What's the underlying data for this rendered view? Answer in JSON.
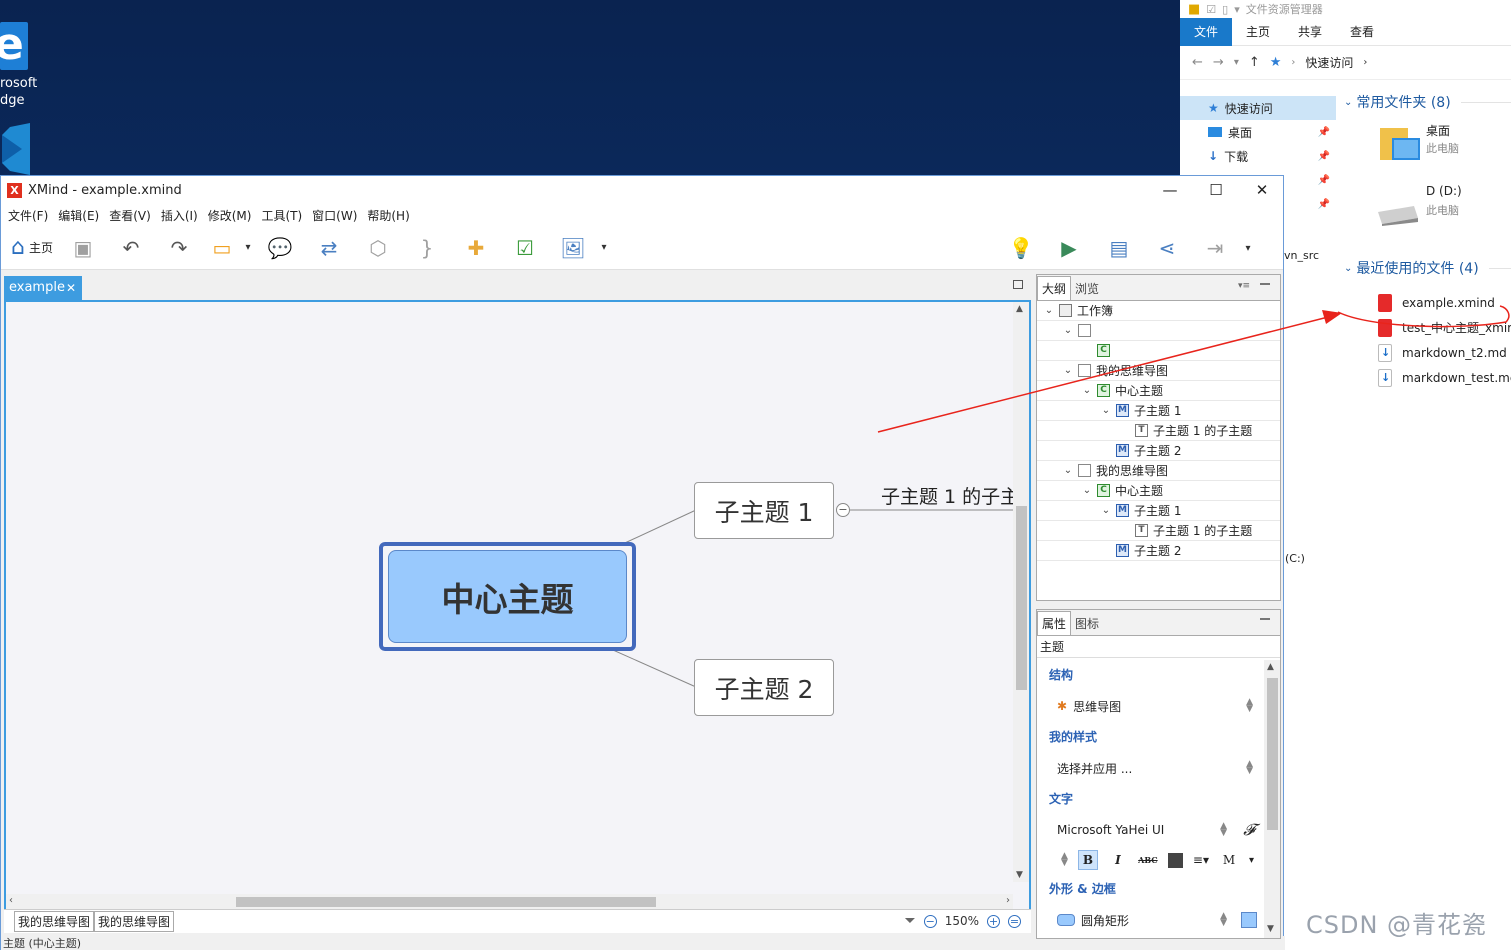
{
  "desktop": {
    "edge_label_line1": "rosoft",
    "edge_label_line2": "dge",
    "edge_glyph": "e"
  },
  "explorer": {
    "title": "文件资源管理器",
    "ribbon_tabs": [
      "文件",
      "主页",
      "共享",
      "查看"
    ],
    "breadcrumb": "快速访问",
    "nav_items": [
      {
        "label": "快速访问",
        "icon": "star-icon"
      },
      {
        "label": "桌面",
        "icon": "desktop-folder-icon"
      },
      {
        "label": "下载",
        "icon": "download-icon"
      }
    ],
    "partial_labels": [
      "vn_src",
      "(C:)"
    ],
    "frequent_header": "常用文件夹 (8)",
    "frequent": [
      {
        "name": "桌面",
        "sub": "此电脑"
      },
      {
        "name": "D (D:)",
        "sub": "此电脑"
      }
    ],
    "recent_header": "最近使用的文件 (4)",
    "recent": [
      {
        "name": "example.xmind",
        "type": "xmind"
      },
      {
        "name": "test_中心主题_xmir",
        "type": "xmind"
      },
      {
        "name": "markdown_t2.md",
        "type": "md"
      },
      {
        "name": "markdown_test.mc",
        "type": "md"
      }
    ]
  },
  "xmind": {
    "title": "XMind - example.xmind",
    "logo": "X",
    "window_controls": {
      "minimize": "—",
      "maximize": "☐",
      "close": "✕"
    },
    "menu": [
      "文件(F)",
      "编辑(E)",
      "查看(V)",
      "插入(I)",
      "修改(M)",
      "工具(T)",
      "窗口(W)",
      "帮助(H)"
    ],
    "toolbar": {
      "home_label": "主页"
    },
    "editor_tab": "example",
    "map": {
      "central": "中心主题",
      "sub1": "子主题 1",
      "sub2": "子主题 2",
      "floating": "子主题 1 的子主"
    },
    "sheet_tabs": [
      "我的思维导图",
      "我的思维导图"
    ],
    "zoom": "150%",
    "status": "主题 (中心主题)",
    "outline": {
      "tabs": [
        "大纲",
        "浏览"
      ],
      "rows": [
        {
          "indent": 0,
          "twisty": "v",
          "icon": "wb",
          "glyph": "",
          "label": "工作簿"
        },
        {
          "indent": 1,
          "twisty": "v",
          "icon": "sheet",
          "glyph": "",
          "label": ""
        },
        {
          "indent": 2,
          "twisty": "",
          "icon": "c",
          "glyph": "C",
          "label": ""
        },
        {
          "indent": 1,
          "twisty": "v",
          "icon": "sheet",
          "glyph": "",
          "label": "我的思维导图"
        },
        {
          "indent": 2,
          "twisty": "v",
          "icon": "c",
          "glyph": "C",
          "label": "中心主题"
        },
        {
          "indent": 3,
          "twisty": "v",
          "icon": "m",
          "glyph": "M",
          "label": "子主题 1"
        },
        {
          "indent": 4,
          "twisty": "",
          "icon": "t",
          "glyph": "T",
          "label": "子主题 1 的子主题"
        },
        {
          "indent": 3,
          "twisty": "",
          "icon": "m",
          "glyph": "M",
          "label": "子主题 2"
        },
        {
          "indent": 1,
          "twisty": "v",
          "icon": "sheet",
          "glyph": "",
          "label": "我的思维导图"
        },
        {
          "indent": 2,
          "twisty": "v",
          "icon": "c",
          "glyph": "C",
          "label": "中心主题"
        },
        {
          "indent": 3,
          "twisty": "v",
          "icon": "m",
          "glyph": "M",
          "label": "子主题 1"
        },
        {
          "indent": 4,
          "twisty": "",
          "icon": "t",
          "glyph": "T",
          "label": "子主题 1 的子主题"
        },
        {
          "indent": 3,
          "twisty": "",
          "icon": "m",
          "glyph": "M",
          "label": "子主题 2"
        }
      ]
    },
    "props": {
      "tabs": [
        "属性",
        "图标"
      ],
      "head": "主题",
      "structure_title": "结构",
      "structure_value": "思维导图",
      "style_title": "我的样式",
      "style_value": "选择并应用 ...",
      "text_title": "文字",
      "font_value": "Microsoft YaHei UI",
      "font_extra": "𝓕",
      "format_buttons": {
        "bold": "B",
        "italic": "I",
        "strike": "ABC",
        "case": "M"
      },
      "shape_title": "外形 & 边框",
      "shape_value": "圆角矩形"
    }
  },
  "watermark": "CSDN @青花瓷",
  "colors": {
    "accent": "#3d9ce0",
    "central_fill": "#99c9fd",
    "central_border": "#4369bc",
    "annotation": "#e8241c"
  }
}
